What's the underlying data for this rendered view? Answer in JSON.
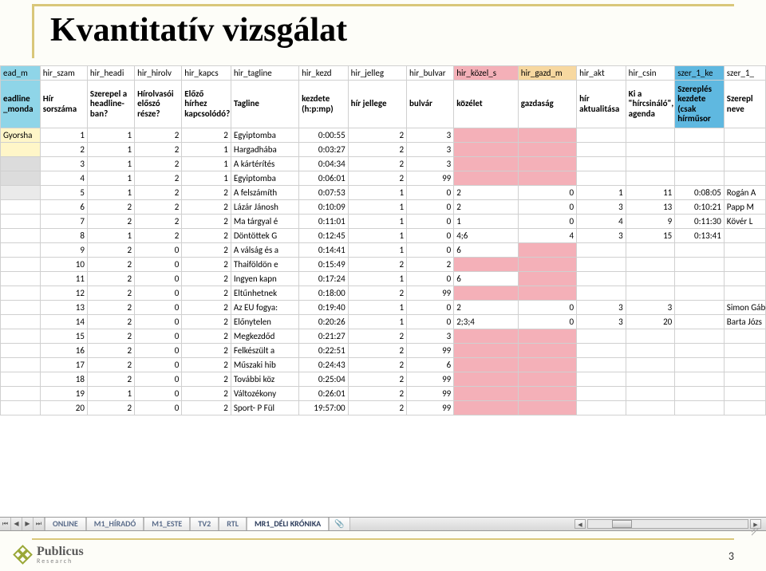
{
  "title": "Kvantitatív vizsgálat",
  "page_number": "3",
  "logo": {
    "main": "Publicus",
    "sub": "Research"
  },
  "tabs": [
    "ONLINE",
    "M1_HÍRADÓ",
    "M1_ESTE",
    "TV2",
    "RTL",
    "MR1_DÉLI KRÓNIKA"
  ],
  "headers_row1": [
    "ead_m",
    "hir_szam",
    "hir_headi",
    "hir_hirolv",
    "hir_kapcs",
    "hir_tagline",
    "hir_kezd",
    "hir_jelleg",
    "hir_bulvar",
    "hir_közel_s",
    "hir_gazd_m",
    "hir_akt",
    "hir_csin",
    "szer_1_ke",
    "szer_1_"
  ],
  "headers_row2": [
    "eadline _monda",
    "Hír sorszáma",
    "Szerepel a headline-ban?",
    "Hírolvasói előszó része?",
    "Előző hírhez kapcsolódó?",
    "Tagline",
    "kezdete (h:p:mp)",
    "hír jellege",
    "bulvár",
    "közélet",
    "gazdaság",
    "hír aktualitása",
    "Ki a \"hírcsináló\", agenda",
    "Szereplés kezdete (csak hírműsor",
    "Szerepl neve"
  ],
  "first_cell_row0": "Gyorsha",
  "rows": [
    {
      "szam": "1",
      "head": "1",
      "hirolv": "2",
      "kapcs": "2",
      "tag": "Egyiptomba",
      "kezd": "0:00:55",
      "jelleg": "2",
      "bulvar": "3",
      "kozel": "",
      "gazd": "",
      "akt": "",
      "csin": "",
      "szer1k": "",
      "szer1": ""
    },
    {
      "szam": "2",
      "head": "1",
      "hirolv": "2",
      "kapcs": "1",
      "tag": "Hargadhába",
      "kezd": "0:03:27",
      "jelleg": "2",
      "bulvar": "3",
      "kozel": "",
      "gazd": "",
      "akt": "",
      "csin": "",
      "szer1k": "",
      "szer1": ""
    },
    {
      "szam": "3",
      "head": "1",
      "hirolv": "2",
      "kapcs": "1",
      "tag": "A kártérítés",
      "kezd": "0:04:34",
      "jelleg": "2",
      "bulvar": "3",
      "kozel": "",
      "gazd": "",
      "akt": "",
      "csin": "",
      "szer1k": "",
      "szer1": ""
    },
    {
      "szam": "4",
      "head": "1",
      "hirolv": "2",
      "kapcs": "1",
      "tag": "Egyiptomba",
      "kezd": "0:06:01",
      "jelleg": "2",
      "bulvar": "99",
      "kozel": "",
      "gazd": "",
      "akt": "",
      "csin": "",
      "szer1k": "",
      "szer1": ""
    },
    {
      "szam": "5",
      "head": "1",
      "hirolv": "2",
      "kapcs": "2",
      "tag": "A felszámíth",
      "kezd": "0:07:53",
      "jelleg": "1",
      "bulvar": "0",
      "kozel": "2",
      "gazd": "0",
      "akt": "1",
      "csin": "11",
      "szer1k": "0:08:05",
      "szer1": "Rogán A"
    },
    {
      "szam": "6",
      "head": "2",
      "hirolv": "2",
      "kapcs": "2",
      "tag": "Lázár Jánosh",
      "kezd": "0:10:09",
      "jelleg": "1",
      "bulvar": "0",
      "kozel": "2",
      "gazd": "0",
      "akt": "3",
      "csin": "13",
      "szer1k": "0:10:21",
      "szer1": "Papp M"
    },
    {
      "szam": "7",
      "head": "2",
      "hirolv": "2",
      "kapcs": "2",
      "tag": "Ma tárgyal é",
      "kezd": "0:11:01",
      "jelleg": "1",
      "bulvar": "0",
      "kozel": "1",
      "gazd": "0",
      "akt": "4",
      "csin": "9",
      "szer1k": "0:11:30",
      "szer1": "Kövér L"
    },
    {
      "szam": "8",
      "head": "1",
      "hirolv": "2",
      "kapcs": "2",
      "tag": "Döntöttek G",
      "kezd": "0:12:45",
      "jelleg": "1",
      "bulvar": "0",
      "kozel": "4;6",
      "gazd": "4",
      "akt": "3",
      "csin": "15",
      "szer1k": "0:13:41",
      "szer1": ""
    },
    {
      "szam": "9",
      "head": "2",
      "hirolv": "0",
      "kapcs": "2",
      "tag": "A válság és a",
      "kezd": "0:14:41",
      "jelleg": "1",
      "bulvar": "0",
      "kozel": "6",
      "gazd": "",
      "akt": "",
      "csin": "",
      "szer1k": "",
      "szer1": ""
    },
    {
      "szam": "10",
      "head": "2",
      "hirolv": "0",
      "kapcs": "2",
      "tag": "Thaiföldön e",
      "kezd": "0:15:49",
      "jelleg": "2",
      "bulvar": "2",
      "kozel": "",
      "gazd": "",
      "akt": "",
      "csin": "",
      "szer1k": "",
      "szer1": ""
    },
    {
      "szam": "11",
      "head": "2",
      "hirolv": "0",
      "kapcs": "2",
      "tag": "Ingyen kapn",
      "kezd": "0:17:24",
      "jelleg": "1",
      "bulvar": "0",
      "kozel": "6",
      "gazd": "",
      "akt": "",
      "csin": "",
      "szer1k": "",
      "szer1": ""
    },
    {
      "szam": "12",
      "head": "2",
      "hirolv": "0",
      "kapcs": "2",
      "tag": "Eltűnhetnek",
      "kezd": "0:18:00",
      "jelleg": "2",
      "bulvar": "99",
      "kozel": "",
      "gazd": "",
      "akt": "",
      "csin": "",
      "szer1k": "",
      "szer1": ""
    },
    {
      "szam": "13",
      "head": "2",
      "hirolv": "0",
      "kapcs": "2",
      "tag": "Az EU fogya:",
      "kezd": "0:19:40",
      "jelleg": "1",
      "bulvar": "0",
      "kozel": "2",
      "gazd": "0",
      "akt": "3",
      "csin": "3",
      "szer1k": "",
      "szer1": "Simon Gáb"
    },
    {
      "szam": "14",
      "head": "2",
      "hirolv": "0",
      "kapcs": "2",
      "tag": "Előnytelen",
      "kezd": "0:20:26",
      "jelleg": "1",
      "bulvar": "0",
      "kozel": "2;3;4",
      "gazd": "0",
      "akt": "3",
      "csin": "20",
      "szer1k": "",
      "szer1": "Barta Józs"
    },
    {
      "szam": "15",
      "head": "2",
      "hirolv": "0",
      "kapcs": "2",
      "tag": "Megkezdőd",
      "kezd": "0:21:27",
      "jelleg": "2",
      "bulvar": "3",
      "kozel": "",
      "gazd": "",
      "akt": "",
      "csin": "",
      "szer1k": "",
      "szer1": ""
    },
    {
      "szam": "16",
      "head": "2",
      "hirolv": "0",
      "kapcs": "2",
      "tag": "Felkészült a",
      "kezd": "0:22:51",
      "jelleg": "2",
      "bulvar": "99",
      "kozel": "",
      "gazd": "",
      "akt": "",
      "csin": "",
      "szer1k": "",
      "szer1": ""
    },
    {
      "szam": "17",
      "head": "2",
      "hirolv": "0",
      "kapcs": "2",
      "tag": "Műszaki hib",
      "kezd": "0:24:43",
      "jelleg": "2",
      "bulvar": "6",
      "kozel": "",
      "gazd": "",
      "akt": "",
      "csin": "",
      "szer1k": "",
      "szer1": ""
    },
    {
      "szam": "18",
      "head": "2",
      "hirolv": "0",
      "kapcs": "2",
      "tag": "További köz",
      "kezd": "0:25:04",
      "jelleg": "2",
      "bulvar": "99",
      "kozel": "",
      "gazd": "",
      "akt": "",
      "csin": "",
      "szer1k": "",
      "szer1": ""
    },
    {
      "szam": "19",
      "head": "1",
      "hirolv": "0",
      "kapcs": "2",
      "tag": "Változékony",
      "kezd": "0:26:01",
      "jelleg": "2",
      "bulvar": "99",
      "kozel": "",
      "gazd": "",
      "akt": "",
      "csin": "",
      "szer1k": "",
      "szer1": ""
    },
    {
      "szam": "20",
      "head": "2",
      "hirolv": "0",
      "kapcs": "2",
      "tag": "Sport- P Fül",
      "kezd": "19:57:00",
      "jelleg": "2",
      "bulvar": "99",
      "kozel": "",
      "gazd": "",
      "akt": "",
      "csin": "",
      "szer1k": "",
      "szer1": ""
    }
  ]
}
